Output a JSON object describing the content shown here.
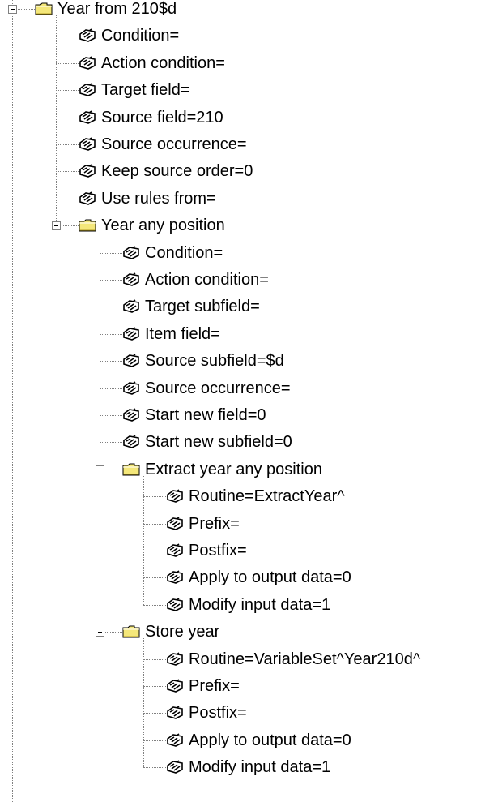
{
  "tree": {
    "nodes": [
      {
        "type": "folder",
        "level": 0,
        "label": "Year from 210$d"
      },
      {
        "type": "prop",
        "level": 1,
        "label": "Condition="
      },
      {
        "type": "prop",
        "level": 1,
        "label": "Action condition="
      },
      {
        "type": "prop",
        "level": 1,
        "label": "Target field="
      },
      {
        "type": "prop",
        "level": 1,
        "label": "Source field=210"
      },
      {
        "type": "prop",
        "level": 1,
        "label": "Source occurrence="
      },
      {
        "type": "prop",
        "level": 1,
        "label": "Keep source order=0"
      },
      {
        "type": "prop",
        "level": 1,
        "label": "Use rules from="
      },
      {
        "type": "folder",
        "level": 1,
        "label": "Year any position"
      },
      {
        "type": "prop",
        "level": 2,
        "label": "Condition="
      },
      {
        "type": "prop",
        "level": 2,
        "label": "Action condition="
      },
      {
        "type": "prop",
        "level": 2,
        "label": "Target subfield="
      },
      {
        "type": "prop",
        "level": 2,
        "label": "Item field="
      },
      {
        "type": "prop",
        "level": 2,
        "label": "Source subfield=$d"
      },
      {
        "type": "prop",
        "level": 2,
        "label": "Source occurrence="
      },
      {
        "type": "prop",
        "level": 2,
        "label": "Start new field=0"
      },
      {
        "type": "prop",
        "level": 2,
        "label": "Start new subfield=0"
      },
      {
        "type": "folder",
        "level": 2,
        "label": "Extract year any position"
      },
      {
        "type": "prop",
        "level": 3,
        "label": "Routine=ExtractYear^"
      },
      {
        "type": "prop",
        "level": 3,
        "label": "Prefix="
      },
      {
        "type": "prop",
        "level": 3,
        "label": "Postfix="
      },
      {
        "type": "prop",
        "level": 3,
        "label": "Apply to output data=0"
      },
      {
        "type": "prop",
        "level": 3,
        "label": "Modify input data=1"
      },
      {
        "type": "folder",
        "level": 2,
        "label": "Store year"
      },
      {
        "type": "prop",
        "level": 3,
        "label": "Routine=VariableSet^Year210d^"
      },
      {
        "type": "prop",
        "level": 3,
        "label": "Prefix="
      },
      {
        "type": "prop",
        "level": 3,
        "label": "Postfix="
      },
      {
        "type": "prop",
        "level": 3,
        "label": "Apply to output data=0"
      },
      {
        "type": "prop",
        "level": 3,
        "label": "Modify input data=1"
      }
    ]
  },
  "colors": {
    "folder_fill": "#f4e77a",
    "folder_stroke": "#000000",
    "connector": "#808080"
  },
  "icons": {
    "folder": "folder-icon",
    "property": "property-tag-icon",
    "expander": "collapse-box-icon"
  }
}
